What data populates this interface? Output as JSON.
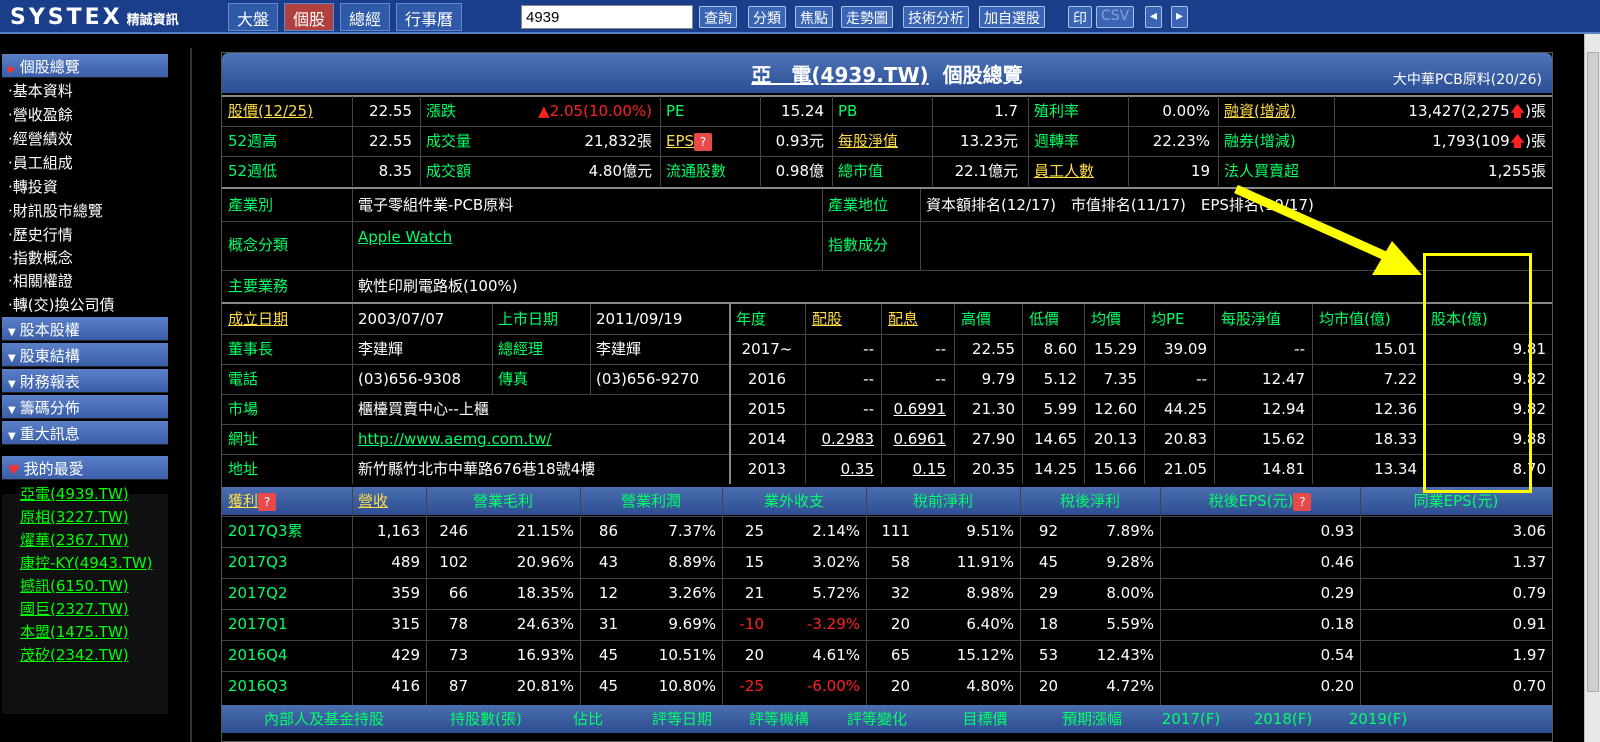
{
  "topbar": {
    "logo": "SYSTEX",
    "logo_sub": "精誠資訊",
    "tabs": [
      "大盤",
      "個股",
      "總經",
      "行事曆"
    ],
    "stock_code": "4939",
    "buttons": [
      "查詢",
      "分類",
      "焦點",
      "走勢圖",
      "技術分析",
      "加自選股"
    ],
    "print": "印",
    "csv": "CSV",
    "prev": "◂",
    "next": "▸"
  },
  "sidebar": {
    "overview_title": "個股總覽",
    "items": [
      "·基本資料",
      "·營收盈餘",
      "·經營績效",
      "·員工組成",
      "·轉投資",
      "·財訊股市總覽",
      "·歷史行情",
      "·指數概念",
      "·相關權證",
      "·轉(交)換公司債"
    ],
    "sections": [
      "股本股權",
      "股東結構",
      "財務報表",
      "籌碼分佈",
      "重大訊息"
    ],
    "fav_title": "我的最愛",
    "favorites": [
      "亞電(4939.TW)",
      "原相(3227.TW)",
      "燿華(2367.TW)",
      "康控-KY(4943.TW)",
      "撼訊(6150.TW)",
      "國巨(2327.TW)",
      "本盟(1475.TW)",
      "茂矽(2342.TW)"
    ]
  },
  "header": {
    "name": "亞　電(4939.TW)",
    "suffix": "個股總覽",
    "industry_rank": "大中華PCB原料(20/26)"
  },
  "quote": {
    "price_label": "股價(12/25)",
    "price": "22.55",
    "chg_label": "漲跌",
    "chg": "▲2.05",
    "chg_pct": "(10.00%)",
    "pe_label": "PE",
    "pe": "15.24",
    "pb_label": "PB",
    "pb": "1.7",
    "yield_label": "殖利率",
    "yield": "0.00%",
    "margin_label": "融資(增減)",
    "margin": "13,427(2,275",
    "margin_unit": "張",
    "hi52_label": "52週高",
    "hi52": "22.55",
    "vol_label": "成交量",
    "vol": "21,832張",
    "eps_label": "EPS",
    "eps": "0.93元",
    "nav_label": "每股淨值",
    "nav": "13.23元",
    "turn_label": "週轉率",
    "turn": "22.23%",
    "short_label": "融券(增減)",
    "short": "1,793(109",
    "short_unit": "張",
    "lo52_label": "52週低",
    "lo52": "8.35",
    "amt_label": "成交額",
    "amt": "4.80億元",
    "float_label": "流通股數",
    "float": "0.98億",
    "mcap_label": "總市值",
    "mcap": "22.1億元",
    "emp_label": "員工人數",
    "emp": "19",
    "inst_label": "法人買賣超",
    "inst": "1,255張"
  },
  "info": {
    "ind_label": "產業別",
    "ind": "電子零組件業-PCB原料",
    "pos_label": "產業地位",
    "pos": "資本額排名(12/17)　市值排名(11/17)　EPS排名(10/17)",
    "concept_label": "概念分類",
    "concept": "Apple Watch",
    "index_label": "指數成分",
    "index": "",
    "biz_label": "主要業務",
    "biz": "軟性印刷電路板(100%)"
  },
  "company": {
    "founded_label": "成立日期",
    "founded": "2003/07/07",
    "listed_label": "上市日期",
    "listed": "2011/09/19",
    "chair_label": "董事長",
    "chair": "李建輝",
    "gm_label": "總經理",
    "gm": "李建輝",
    "tel_label": "電話",
    "tel": "(03)656-9308",
    "fax_label": "傳真",
    "fax": "(03)656-9270",
    "mkt_label": "市場",
    "mkt": "櫃檯買賣中心--上櫃",
    "web_label": "網址",
    "web": "http://www.aemg.com.tw/",
    "addr_label": "地址",
    "addr": "新竹縣竹北市中華路676巷18號4樓"
  },
  "yearly": {
    "headers": [
      "年度",
      "配股",
      "配息",
      "高價",
      "低價",
      "均價",
      "均PE",
      "每股淨值",
      "均市值(億)",
      "股本(億)"
    ],
    "rows": [
      [
        "2017~",
        "--",
        "--",
        "22.55",
        "8.60",
        "15.29",
        "39.09",
        "--",
        "15.01",
        "9.81"
      ],
      [
        "2016",
        "--",
        "--",
        "9.79",
        "5.12",
        "7.35",
        "--",
        "12.47",
        "7.22",
        "9.82"
      ],
      [
        "2015",
        "--",
        "0.6991",
        "21.30",
        "5.99",
        "12.60",
        "44.25",
        "12.94",
        "12.36",
        "9.82"
      ],
      [
        "2014",
        "0.2983",
        "0.6961",
        "27.90",
        "14.65",
        "20.13",
        "20.83",
        "15.62",
        "18.33",
        "9.88"
      ],
      [
        "2013",
        "0.35",
        "0.15",
        "20.35",
        "14.25",
        "15.66",
        "21.05",
        "14.81",
        "13.34",
        "8.70"
      ]
    ]
  },
  "profit": {
    "headers": [
      "獲利",
      "營收",
      "營業毛利",
      "營業利潤",
      "業外收支",
      "稅前淨利",
      "稅後淨利",
      "稅後EPS(元)",
      "同業EPS(元)"
    ],
    "rows": [
      [
        "2017Q3累",
        "1,163",
        "246",
        "21.15%",
        "86",
        "7.37%",
        "25",
        "2.14%",
        "111",
        "9.51%",
        "92",
        "7.89%",
        "0.93",
        "3.06"
      ],
      [
        "2017Q3",
        "489",
        "102",
        "20.96%",
        "43",
        "8.89%",
        "15",
        "3.02%",
        "58",
        "11.91%",
        "45",
        "9.28%",
        "0.46",
        "1.37"
      ],
      [
        "2017Q2",
        "359",
        "66",
        "18.35%",
        "12",
        "3.26%",
        "21",
        "5.72%",
        "32",
        "8.98%",
        "29",
        "8.00%",
        "0.29",
        "0.79"
      ],
      [
        "2017Q1",
        "315",
        "78",
        "24.63%",
        "31",
        "9.69%",
        "-10",
        "-3.29%",
        "20",
        "6.40%",
        "18",
        "5.59%",
        "0.18",
        "0.91"
      ],
      [
        "2016Q4",
        "429",
        "73",
        "16.93%",
        "45",
        "10.51%",
        "20",
        "4.61%",
        "65",
        "15.12%",
        "53",
        "12.43%",
        "0.54",
        "1.97"
      ],
      [
        "2016Q3",
        "416",
        "87",
        "20.81%",
        "45",
        "10.80%",
        "-25",
        "-6.00%",
        "20",
        "4.80%",
        "20",
        "4.72%",
        "0.20",
        "0.70"
      ]
    ]
  },
  "bottom_headers": [
    "內部人及基金持股",
    "持股數(張)",
    "佔比",
    "評等日期",
    "評等機構",
    "評等變化",
    "目標價",
    "預期漲幅",
    "2017(F)",
    "2018(F)",
    "2019(F)"
  ],
  "colors": {
    "accent": "#ffff00",
    "up": "#ff2020",
    "label": "#00ff66"
  }
}
